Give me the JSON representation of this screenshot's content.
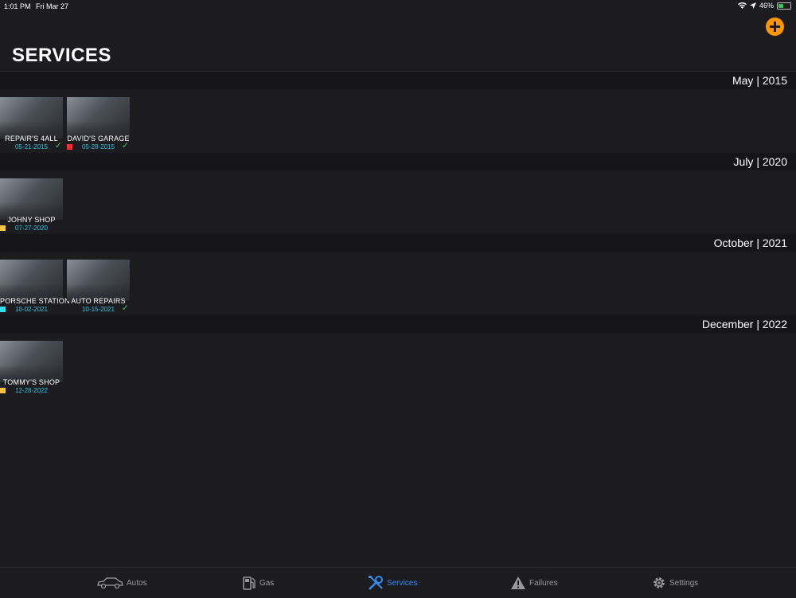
{
  "status": {
    "time": "1:01 PM",
    "date": "Fri Mar 27",
    "battery": "46%",
    "battery_level": 0.46
  },
  "header": {
    "title": "SERVICES"
  },
  "sections": [
    {
      "title": "May | 2015",
      "cards": [
        {
          "name": "REPAIR'S 4ALL",
          "date": "05-21-2015",
          "marker": "",
          "checked": true
        },
        {
          "name": "DAVID'S GARAGE",
          "date": "05-28-2015",
          "marker": "#ff2d2d",
          "checked": true
        }
      ]
    },
    {
      "title": "July | 2020",
      "cards": [
        {
          "name": "JOHNY SHOP",
          "date": "07-27-2020",
          "marker": "#f5c542",
          "checked": false
        }
      ]
    },
    {
      "title": "October | 2021",
      "cards": [
        {
          "name": "PORSCHE STATION",
          "date": "10-02-2021",
          "marker": "#2ee0f0",
          "checked": false
        },
        {
          "name": "AUTO REPAIRS",
          "date": "10-15-2021",
          "marker": "",
          "checked": true
        }
      ]
    },
    {
      "title": "December | 2022",
      "cards": [
        {
          "name": "TOMMY'S SHOP",
          "date": "12-28-2022",
          "marker": "#f5c542",
          "checked": false
        }
      ]
    }
  ],
  "tabs": [
    {
      "label": "Autos",
      "icon": "car-icon",
      "active": false
    },
    {
      "label": "Gas",
      "icon": "gas-pump-icon",
      "active": false
    },
    {
      "label": "Services",
      "icon": "wrench-screwdriver-icon",
      "active": true
    },
    {
      "label": "Failures",
      "icon": "warning-icon",
      "active": false
    },
    {
      "label": "Settings",
      "icon": "gear-icon",
      "active": false
    }
  ],
  "colors": {
    "accent": "#2f8df5",
    "add_button": "#ff9500",
    "date_text": "#2ec4e8",
    "check": "#34c759"
  }
}
